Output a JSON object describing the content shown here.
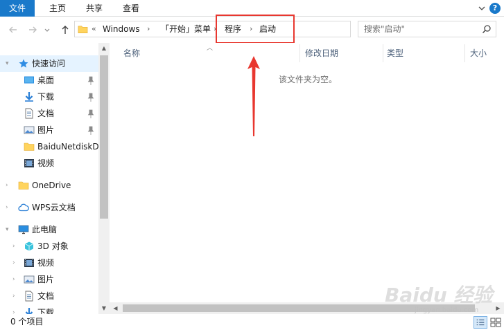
{
  "ribbon": {
    "tabs": [
      "文件",
      "主页",
      "共享",
      "查看"
    ],
    "help": "?"
  },
  "address": {
    "overflow": "«",
    "crumbs": [
      "Windows",
      "「开始」菜单",
      "程序",
      "启动"
    ],
    "separator": "›"
  },
  "search": {
    "placeholder": "搜索\"启动\""
  },
  "nav": {
    "quick_access": "快速访问",
    "items": [
      "桌面",
      "下载",
      "文档",
      "图片",
      "BaiduNetdiskD",
      "视频"
    ],
    "onedrive": "OneDrive",
    "wps": "WPS云文档",
    "this_pc": "此电脑",
    "pc_items": [
      "3D 对象",
      "视频",
      "图片",
      "文档",
      "下载"
    ]
  },
  "columns": {
    "name": "名称",
    "modified": "修改日期",
    "type": "类型",
    "size": "大小"
  },
  "content": {
    "empty_message": "该文件夹为空。"
  },
  "status": {
    "item_count": "0 个项目"
  },
  "watermark": {
    "brand": "Baidu 经验",
    "url": "jingyan.baidu.com"
  },
  "colors": {
    "accent": "#1979ca",
    "highlight": "#e8372f"
  }
}
